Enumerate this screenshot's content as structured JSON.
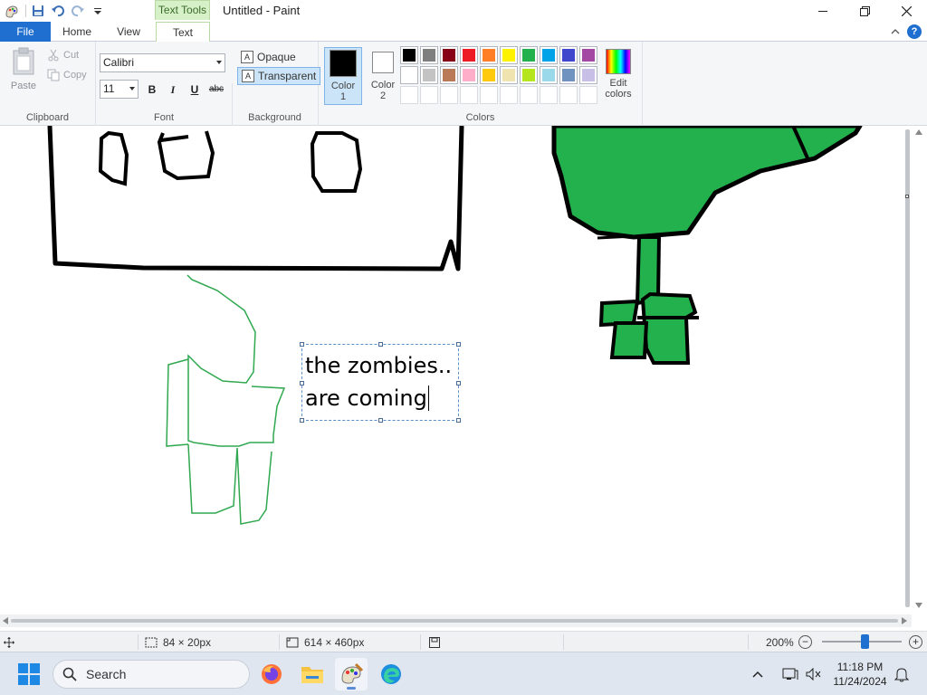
{
  "window": {
    "title": "Untitled - Paint",
    "contextual_group": "Text Tools"
  },
  "tabs": {
    "file": "File",
    "home": "Home",
    "view": "View",
    "text": "Text"
  },
  "ribbon": {
    "clipboard": {
      "paste": "Paste",
      "cut": "Cut",
      "copy": "Copy",
      "label": "Clipboard"
    },
    "font": {
      "family": "Calibri",
      "size": "11",
      "bold": "B",
      "italic": "I",
      "underline": "U",
      "strikethrough": "abc",
      "label": "Font"
    },
    "background": {
      "opaque": "Opaque",
      "transparent": "Transparent",
      "label": "Background"
    },
    "colors": {
      "color1_label": "Color",
      "color1_num": "1",
      "color2_label": "Color",
      "color2_num": "2",
      "edit_label_1": "Edit",
      "edit_label_2": "colors",
      "label": "Colors",
      "color1_value": "#000000",
      "color2_value": "#ffffff",
      "palette_row1": [
        "#000000",
        "#7f7f7f",
        "#880015",
        "#ed1c24",
        "#ff7f27",
        "#fff200",
        "#22b14c",
        "#00a2e8",
        "#3f48cc",
        "#a349a4"
      ],
      "palette_row2": [
        "#ffffff",
        "#c3c3c3",
        "#b97a57",
        "#ffaec9",
        "#ffc90e",
        "#efe4b0",
        "#b5e61d",
        "#99d9ea",
        "#7092be",
        "#c8bfe7"
      ],
      "palette_row3": [
        "#ffffff",
        "#ffffff",
        "#ffffff",
        "#ffffff",
        "#ffffff",
        "#ffffff",
        "#ffffff",
        "#ffffff",
        "#ffffff",
        "#ffffff"
      ]
    }
  },
  "canvas": {
    "text_line1": "the zombies..",
    "text_line2": "are coming",
    "green": "#22b14c",
    "green_outline": "#2fa84f"
  },
  "status": {
    "selection_size": "84 × 20px",
    "image_size": "614 × 460px",
    "zoom": "200%"
  },
  "taskbar": {
    "search_label": "Search",
    "time": "11:18 PM",
    "date": "11/24/2024"
  }
}
